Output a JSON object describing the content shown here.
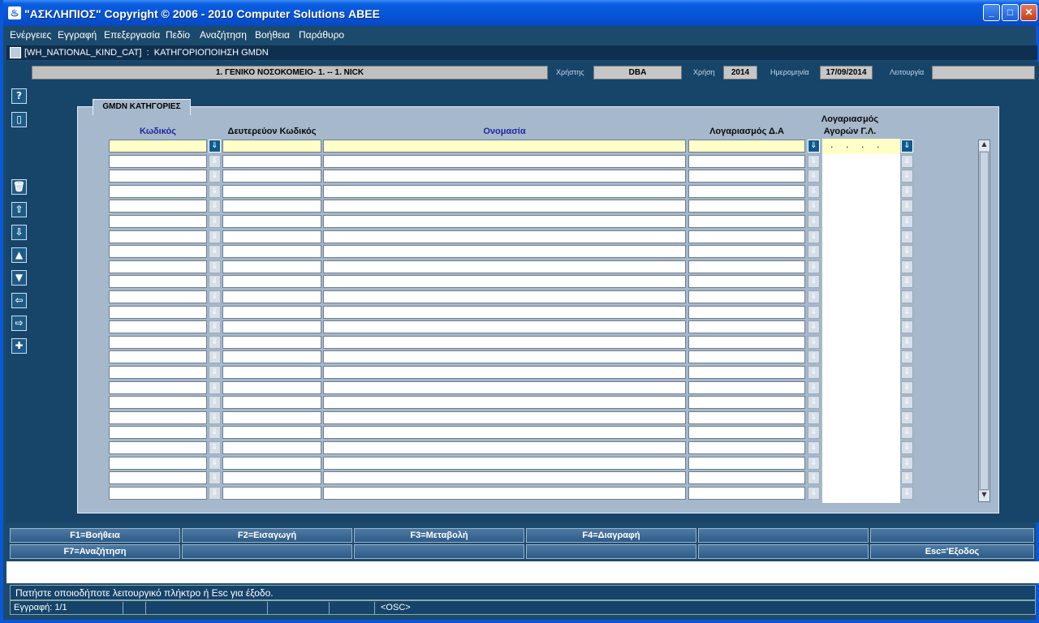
{
  "window": {
    "title": "\"ΑΣΚΛΗΠΙΟΣ\" Copyright © 2006 - 2010 Computer Solutions ΑΒΕΕ",
    "minimize": "_",
    "maximize": "□",
    "close": "✕"
  },
  "menu": [
    "Ενέργειες",
    "Εγγραφή",
    "Επεξεργασία",
    "Πεδίο",
    "Αναζήτηση",
    "Βοήθεια",
    "Παράθυρο"
  ],
  "form_caption": "[WH_NATIONAL_KIND_CAT]  :  ΚΑΤΗΓΟΡΙΟΠΟΙΗΣΗ GMDN",
  "header": {
    "hospital": "1. ΓΕΝΙΚΟ ΝΟΣΟΚΟΜΕΙΟ- 1. -- 1. NICK",
    "user_label": "Χρήστης",
    "user": "DBA",
    "year_label": "Χρήση",
    "year": "2014",
    "date_label": "Ημερομηνία",
    "date": "17/09/2014",
    "function_label": "Λειτουργία",
    "function": ""
  },
  "toolbar": [
    "?",
    "▯",
    "🗑",
    "⇧",
    "⇩",
    "▲",
    "▼",
    "⇦",
    "⇨",
    "✚"
  ],
  "panel": {
    "tab": "GMDN ΚΑΤΗΓΟΡΙΕΣ",
    "columns": {
      "code": "Κωδικός",
      "secondary_code": "Δευτερεύον Κωδικός",
      "name": "Ονομασία",
      "account_da": "Λογαριασμός Δ.Α",
      "account_ga_line1": "Λογαριασμός",
      "account_ga_line2": "Αγορών Γ.Λ."
    },
    "first_row_account_mask": ". . . ."
  },
  "fkeys_row1": [
    "F1=Βοήθεια",
    "F2=Εισαγωγή",
    "F3=Μεταβολή",
    "F4=Διαγραφή",
    "",
    ""
  ],
  "fkeys_row2": [
    "F7=Αναζήτηση",
    "",
    "",
    "",
    "",
    "Esc='Εξοδος"
  ],
  "message": "Πατήστε οποιοδήποτε λειτουργικό πλήκτρο ή Esc για έξοδο.",
  "status": {
    "record": "Εγγραφή: 1/1",
    "mode": "<OSC>"
  }
}
